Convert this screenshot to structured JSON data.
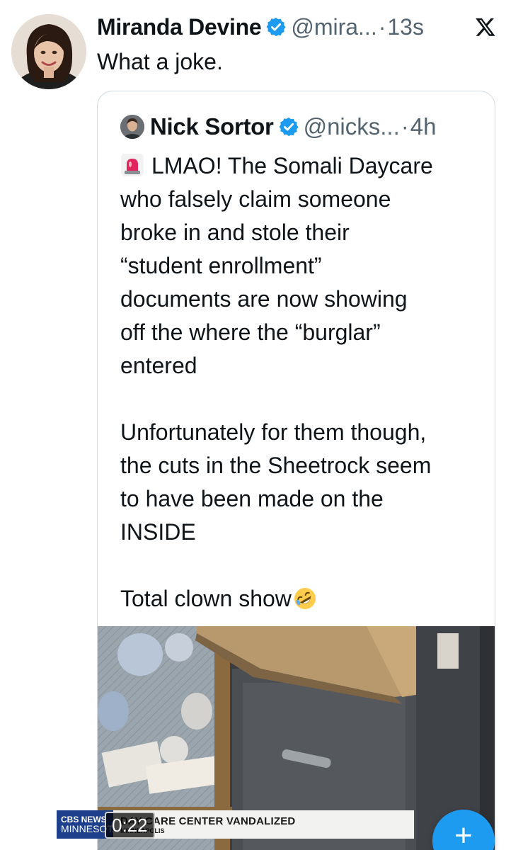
{
  "tweet": {
    "display_name": "Miranda Devine",
    "handle": "@mira...",
    "separator": "·",
    "time": "13s",
    "text": "What a joke.",
    "verified": true
  },
  "quote": {
    "display_name": "Nick Sortor",
    "handle": "@nicks...",
    "separator": "·",
    "time": "4h",
    "verified": true,
    "body": "LMAO! The Somali Daycare\nwho falsely claim someone\nbroke in and stole their\n“student enrollment”\ndocuments are now showing\noff the where the “burglar”\nentered\n\nUnfortunately for them though,\nthe cuts in the Sheetrock seem\nto have been made on the\nINSIDE\n\nTotal clown show",
    "body_leading_icon": "rotating-light-emoji",
    "body_trailing_icon": "rolling-on-floor-laughing-emoji"
  },
  "video": {
    "duration": "0:22",
    "channel_line1": "CBS NEWS",
    "channel_line2": "MINNESOTA",
    "headline": "DAY CARE CENTER VANDALIZED",
    "location": "MINNEAPOLIS"
  },
  "fab": {
    "label": "+"
  },
  "colors": {
    "accent": "#1d9bf0",
    "secondary_text": "#536471",
    "border": "#cfd9de"
  }
}
